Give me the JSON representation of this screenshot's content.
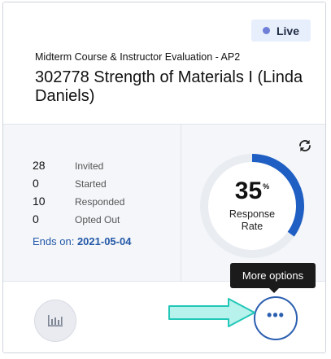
{
  "badge": {
    "label": "Live",
    "dot_color": "#6f7fd8"
  },
  "survey": {
    "subtitle": "Midterm Course & Instructor Evaluation - AP2",
    "title": "302778 Strength of Materials I (Linda Daniels)"
  },
  "stats": [
    {
      "value": "28",
      "label": "Invited"
    },
    {
      "value": "0",
      "label": "Started"
    },
    {
      "value": "10",
      "label": "Responded"
    },
    {
      "value": "0",
      "label": "Opted Out"
    }
  ],
  "ends": {
    "prefix": "Ends on:",
    "date": "2021-05-04"
  },
  "response_rate": {
    "value": "35",
    "unit": "%",
    "label": "Response Rate",
    "fraction": 0.35,
    "accent": "#1f5fc4"
  },
  "tooltip": {
    "label": "More options"
  },
  "icons": {
    "refresh": "refresh-icon",
    "report": "bar-chart-icon",
    "more": "more-horizontal-icon",
    "annotation": "arrow-annotation-icon"
  }
}
